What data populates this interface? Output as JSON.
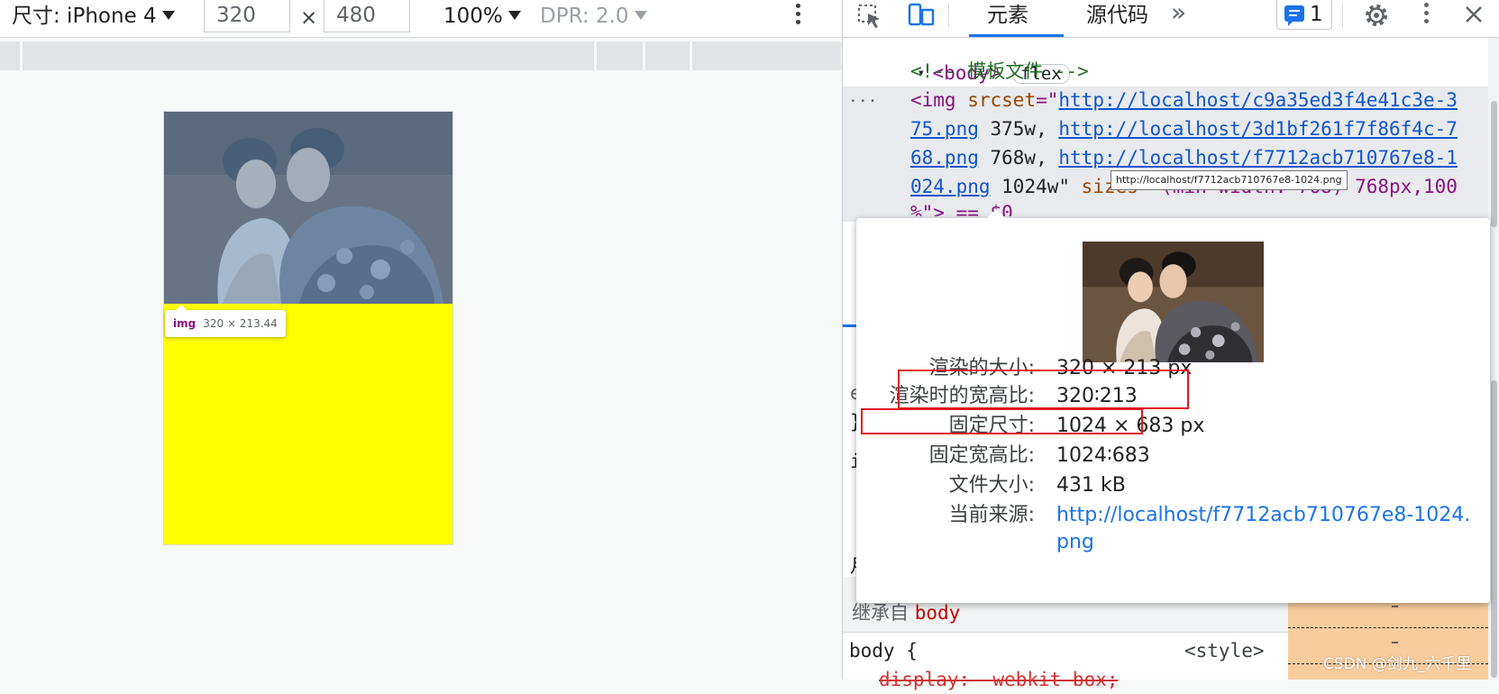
{
  "device_toolbar": {
    "device_label": "尺寸: iPhone 4",
    "width_value": "320",
    "times": "×",
    "height_value": "480",
    "zoom": "100%",
    "dpr": "DPR: 2.0"
  },
  "viewport": {
    "bg_color": "#ffff00",
    "element_tooltip": {
      "tag": "img",
      "dims": "320 × 213.44"
    }
  },
  "devtools": {
    "tabs": {
      "elements": "元素",
      "sources": "源代码",
      "more": "»"
    },
    "issues_count": "1",
    "code": {
      "body_tag": "<body>",
      "flex_pill": "flex",
      "comment": "<!-- 模板文件 -->",
      "ellipsis": "...",
      "img_open": "<img",
      "srcset_attr": "srcset",
      "eq_quote": "=\"",
      "link1a": "http://localhost/c9a35ed3f4e41c3e-3",
      "link1b": "75.png",
      "w1": " 375w, ",
      "link2a": "http://localhost/3d1bf261f7f86f4c-7",
      "link2b": "68.png",
      "w2": " 768w, ",
      "link3a": "http://localhost/f7712acb710767e8-1",
      "link3b": "024.png",
      "w3": " 1024w\" ",
      "sizes_attr": "sizes",
      "sizes_val": "=\"(min-width: 768) 768px,100",
      "cut_line": "%\"> == $0"
    },
    "url_tooltip": "http://localhost/f7712acb710767e8-1024.png",
    "preview": {
      "rows": [
        {
          "key": "渲染的大小:",
          "value": "320 × 213 px"
        },
        {
          "key": "渲染时的宽高比:",
          "value": "320∶213"
        },
        {
          "key": "固定尺寸:",
          "value": "1024 × 683 px"
        },
        {
          "key": "固定宽高比:",
          "value": "1024∶683"
        },
        {
          "key": "文件大小:",
          "value": "431 kB"
        },
        {
          "key": "当前来源:",
          "value": "http://localhost/f7712acb710767e8-1024.png"
        }
      ]
    },
    "styles": {
      "inherited_prefix": "继承自",
      "inherited_from": "body",
      "rule_selector": "body {",
      "rule_source": "<style>",
      "struck_decl": "display: -webkit-box;",
      "box_dash": "–"
    },
    "side_fragments": [
      "e",
      "}",
      "i",
      "月"
    ]
  },
  "watermark": "CSDN @剑九_六千里"
}
